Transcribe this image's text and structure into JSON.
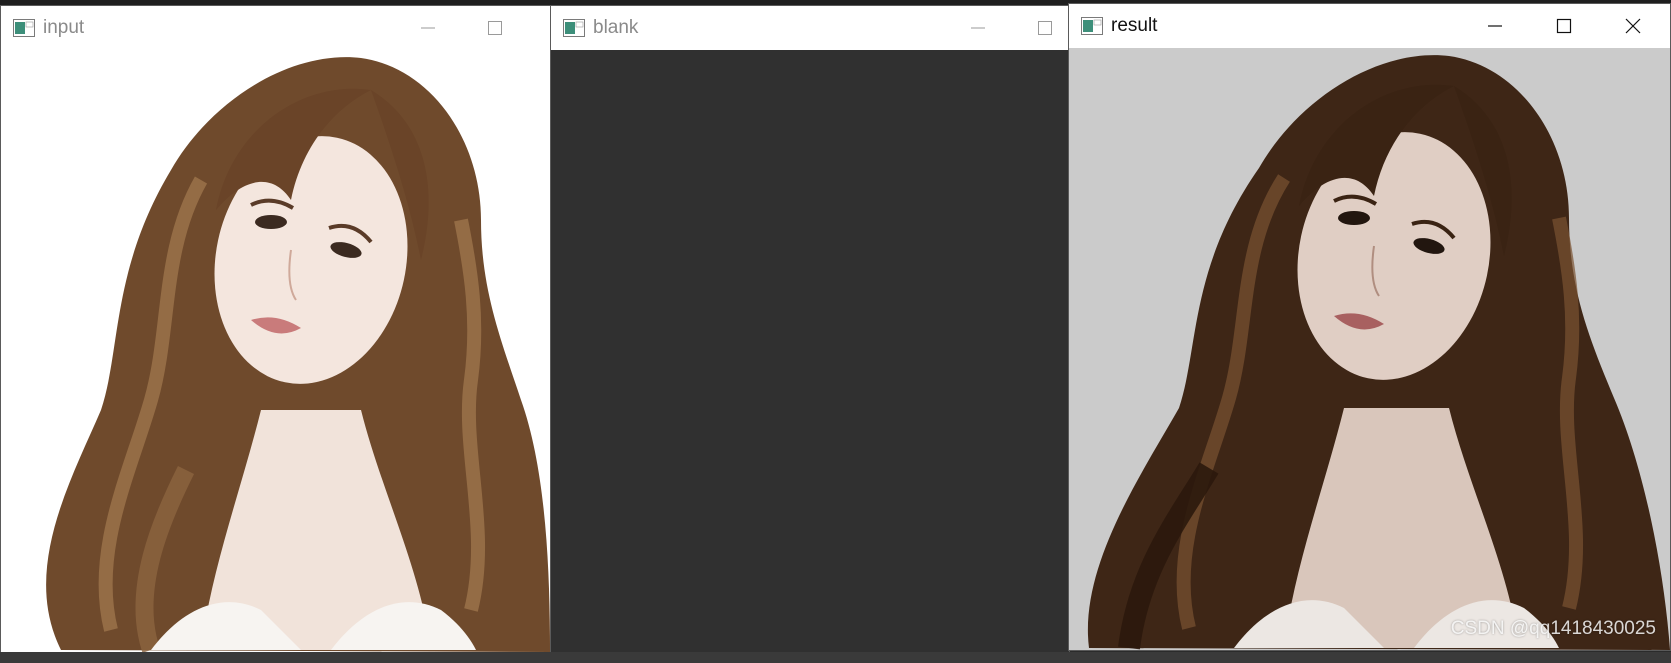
{
  "windows": {
    "input": {
      "title": "input"
    },
    "blank": {
      "title": "blank"
    },
    "result": {
      "title": "result"
    }
  },
  "watermark": "CSDN @qq1418430025",
  "colors": {
    "inactive_title": "#8a8a8a",
    "active_title": "#111111",
    "blank_canvas": "#303030",
    "result_background": "#cbcbcb",
    "input_background": "#ffffff"
  },
  "icons": [
    "app-icon",
    "minimize-icon",
    "maximize-icon",
    "close-icon"
  ]
}
